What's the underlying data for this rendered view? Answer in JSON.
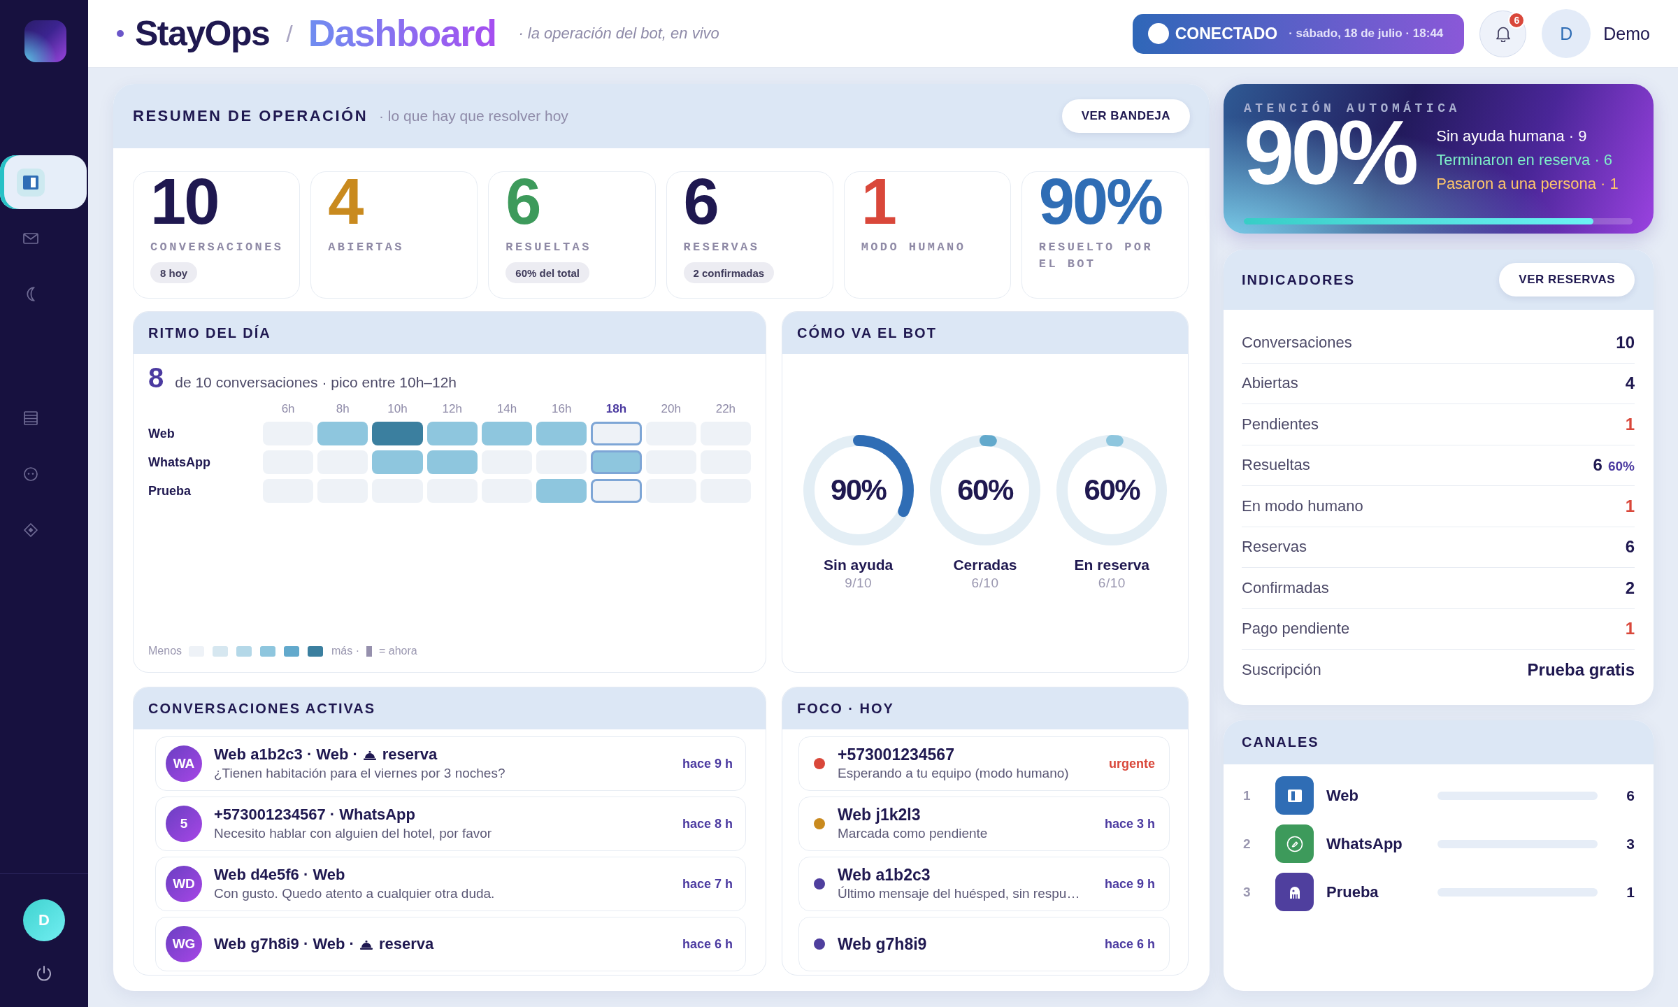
{
  "sidebar": {
    "nav_groups": [
      {
        "items": [
          {
            "selected": true
          },
          {
            "selected": false
          },
          {
            "selected": false
          }
        ]
      },
      {
        "items": [
          {
            "selected": false
          },
          {
            "selected": false
          },
          {
            "selected": false
          }
        ]
      }
    ],
    "user_initial": "D"
  },
  "header": {
    "brand": "StayOps",
    "separator": "/",
    "page_title": "Dashboard",
    "tagline": "· la operación del bot, en vivo",
    "status": {
      "connected": true,
      "label": "CONECTADO",
      "datetime": "· sábado, 18 de julio · 18:44"
    },
    "notifications": {
      "count": "6"
    },
    "user": {
      "initial": "D",
      "name": "Demo"
    }
  },
  "summary": {
    "title": "RESUMEN DE OPERACIÓN",
    "subtitle": "· lo que hay que resolver hoy",
    "action": "VER BANDEJA",
    "stats": [
      {
        "value": "10",
        "label": "CONVERSACIONES",
        "note": "8 hoy",
        "color": "#1f1850"
      },
      {
        "value": "4",
        "label": "ABIERTAS",
        "color": "#c98a1e"
      },
      {
        "value": "6",
        "label": "RESUELTAS",
        "note": "60% del total",
        "color": "#3d9a5b"
      },
      {
        "value": "6",
        "label": "RESERVAS",
        "note": "2 confirmadas",
        "color": "#1f1850"
      },
      {
        "value": "1",
        "label": "MODO HUMANO",
        "color": "#d9473a"
      },
      {
        "value": "90%",
        "label": "RESUELTO POR EL BOT",
        "color": "#2f6db5"
      }
    ]
  },
  "rhythm": {
    "title": "RITMO DEL DÍA",
    "count": "8",
    "caption": "de 10 conversaciones · pico entre 10h–12h",
    "columns": [
      {
        "label": "6h",
        "current": false
      },
      {
        "label": "8h",
        "current": false
      },
      {
        "label": "10h",
        "current": false
      },
      {
        "label": "12h",
        "current": false
      },
      {
        "label": "14h",
        "current": false
      },
      {
        "label": "16h",
        "current": false
      },
      {
        "label": "18h",
        "current": true
      },
      {
        "label": "20h",
        "current": false
      },
      {
        "label": "22h",
        "current": false
      }
    ],
    "rows": [
      {
        "label": "Web",
        "cells": [
          {
            "kind": "empty"
          },
          {
            "kind": "medium"
          },
          {
            "kind": "peak"
          },
          {
            "kind": "medium"
          },
          {
            "kind": "medium"
          },
          {
            "kind": "medium"
          },
          {
            "kind": "empty"
          },
          {
            "kind": "empty"
          },
          {
            "kind": "empty"
          }
        ]
      },
      {
        "label": "WhatsApp",
        "cells": [
          {
            "kind": "empty"
          },
          {
            "kind": "empty"
          },
          {
            "kind": "medium"
          },
          {
            "kind": "medium"
          },
          {
            "kind": "empty"
          },
          {
            "kind": "empty"
          },
          {
            "kind": "medium"
          },
          {
            "kind": "empty"
          },
          {
            "kind": "empty"
          }
        ]
      },
      {
        "label": "Prueba",
        "cells": [
          {
            "kind": "empty"
          },
          {
            "kind": "empty"
          },
          {
            "kind": "empty"
          },
          {
            "kind": "empty"
          },
          {
            "kind": "empty"
          },
          {
            "kind": "medium"
          },
          {
            "kind": "empty"
          },
          {
            "kind": "empty"
          },
          {
            "kind": "empty"
          }
        ]
      }
    ],
    "legend": {
      "less": "Menos",
      "more": "más ·",
      "now": "= ahora"
    }
  },
  "bot": {
    "title": "CÓMO VA EL BOT",
    "rings": [
      {
        "percent": "90%",
        "label": "Sin ayuda",
        "ratio": "9/10",
        "level": 0.32,
        "color": "#2f6db5"
      },
      {
        "percent": "60%",
        "label": "Cerradas",
        "ratio": "6/10",
        "level": 0.02,
        "color": "#62a9cc"
      },
      {
        "percent": "60%",
        "label": "En reserva",
        "ratio": "6/10",
        "level": 0.02,
        "color": "#8ec6de"
      }
    ]
  },
  "conversations": {
    "title": "CONVERSACIONES ACTIVAS",
    "items": [
      {
        "initials": "WA",
        "title": "Web a1b2c3 · Web ·",
        "tag": "reserva",
        "preview": "¿Tienen habitación para el viernes por 3 noches?",
        "time": "hace 9 h"
      },
      {
        "initials": "5",
        "title": "+573001234567 · WhatsApp",
        "preview": "Necesito hablar con alguien del hotel, por favor",
        "time": "hace 8 h"
      },
      {
        "initials": "WD",
        "title": "Web d4e5f6 · Web",
        "preview": "Con gusto. Quedo atento a cualquier otra duda.",
        "time": "hace 7 h"
      },
      {
        "initials": "WG",
        "title": "Web g7h8i9 · Web ·",
        "tag": "reserva",
        "time": "hace 6 h"
      }
    ]
  },
  "focus": {
    "title": "FOCO · HOY",
    "items": [
      {
        "color": "#d9473a",
        "title": "+573001234567",
        "subtitle": "Esperando a tu equipo (modo humano)",
        "time": "urgente",
        "urgent": true
      },
      {
        "color": "#c98a1e",
        "title": "Web j1k2l3",
        "subtitle": "Marcada como pendiente",
        "time": "hace 3 h",
        "urgent": false
      },
      {
        "color": "#4f3f9e",
        "title": "Web a1b2c3",
        "subtitle": "Último mensaje del huésped, sin respu…",
        "time": "hace 9 h",
        "urgent": false
      },
      {
        "color": "#4f3f9e",
        "title": "Web g7h8i9",
        "time": "hace 6 h",
        "urgent": false
      }
    ]
  },
  "automation": {
    "eyebrow": "ATENCIÓN AUTOMÁTICA",
    "value": "90%",
    "lines": [
      {
        "text": "Sin ayuda humana · 9",
        "color": "#ffffff"
      },
      {
        "text": "Terminaron en reserva · 6",
        "color": "#7eeec8"
      },
      {
        "text": "Pasaron a una persona · 1",
        "color": "#ffc76a"
      }
    ],
    "level": 0.9
  },
  "indicators": {
    "title": "INDICADORES",
    "action": "VER RESERVAS",
    "rows": [
      {
        "label": "Conversaciones",
        "value": "10",
        "alert": false
      },
      {
        "label": "Abiertas",
        "value": "4",
        "alert": false
      },
      {
        "label": "Pendientes",
        "value": "1",
        "alert": true
      },
      {
        "label": "Resueltas",
        "value": "6",
        "extra": "60%",
        "alert": false
      },
      {
        "label": "En modo humano",
        "value": "1",
        "alert": true
      },
      {
        "label": "Reservas",
        "value": "6",
        "alert": false
      },
      {
        "label": "Confirmadas",
        "value": "2",
        "alert": false
      },
      {
        "label": "Pago pendiente",
        "value": "1",
        "alert": true
      },
      {
        "label": "Suscripción",
        "value": "Prueba gratis",
        "alert": false
      }
    ]
  },
  "channels": {
    "title": "CANALES",
    "items": [
      {
        "rank": "1",
        "kind": "web",
        "name": "Web",
        "count": "6",
        "color": "#2f6db5"
      },
      {
        "rank": "2",
        "kind": "whatsapp",
        "name": "WhatsApp",
        "count": "3",
        "color": "#3d9a5b"
      },
      {
        "rank": "3",
        "kind": "test",
        "name": "Prueba",
        "count": "1",
        "color": "#4f3f9e"
      }
    ]
  }
}
